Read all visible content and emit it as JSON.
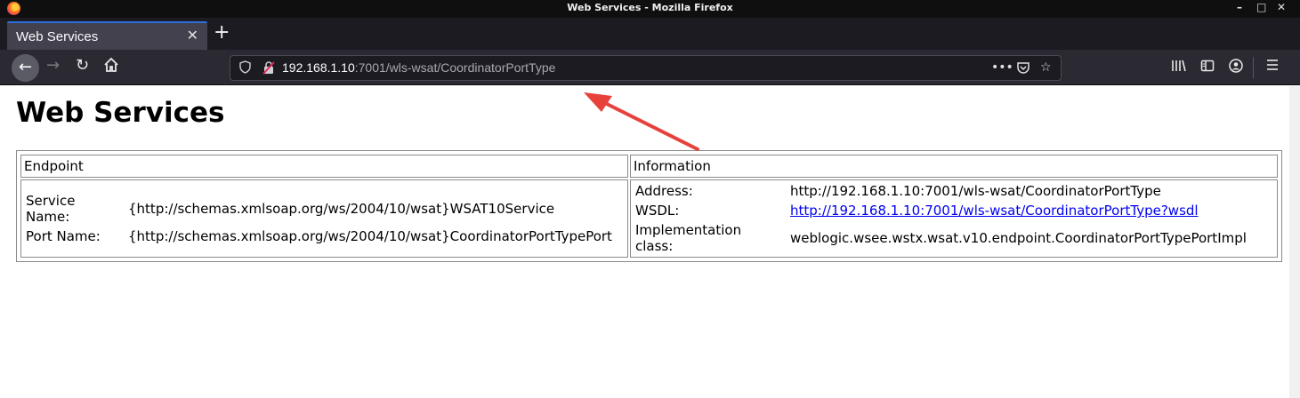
{
  "window": {
    "title": "Web Services - Mozilla Firefox",
    "controls": [
      "–",
      "□",
      "✕"
    ]
  },
  "tab": {
    "title": "Web Services",
    "close": "✕",
    "new_tab": "+"
  },
  "urlbar": {
    "host": "192.168.1.10",
    "path": ":7001/wls-wsat/CoordinatorPortType"
  },
  "page": {
    "title": "Web Services",
    "headers": [
      "Endpoint",
      "Information"
    ],
    "endpoint": {
      "service_name_label": "Service Name:",
      "service_name_value": "{http://schemas.xmlsoap.org/ws/2004/10/wsat}WSAT10Service",
      "port_name_label": "Port Name:",
      "port_name_value": "{http://schemas.xmlsoap.org/ws/2004/10/wsat}CoordinatorPortTypePort"
    },
    "information": {
      "address_label": "Address:",
      "address_value": "http://192.168.1.10:7001/wls-wsat/CoordinatorPortType",
      "wsdl_label": "WSDL:",
      "wsdl_value": "http://192.168.1.10:7001/wls-wsat/CoordinatorPortType?wsdl",
      "impl_label": "Implementation class:",
      "impl_value": "weblogic.wsee.wstx.wsat.v10.endpoint.CoordinatorPortTypePortImpl"
    }
  },
  "colors": {
    "annotation_arrow": "#e8413c",
    "link": "#0000ee",
    "tab_accent": "#2a6fdc"
  },
  "icons": [
    "firefox-logo-icon",
    "back-icon",
    "forward-icon",
    "reload-icon",
    "home-icon",
    "shield-icon",
    "insecure-lock-icon",
    "page-actions-icon",
    "pocket-icon",
    "bookmark-star-icon",
    "library-icon",
    "sidebar-icon",
    "account-icon",
    "menu-icon"
  ]
}
